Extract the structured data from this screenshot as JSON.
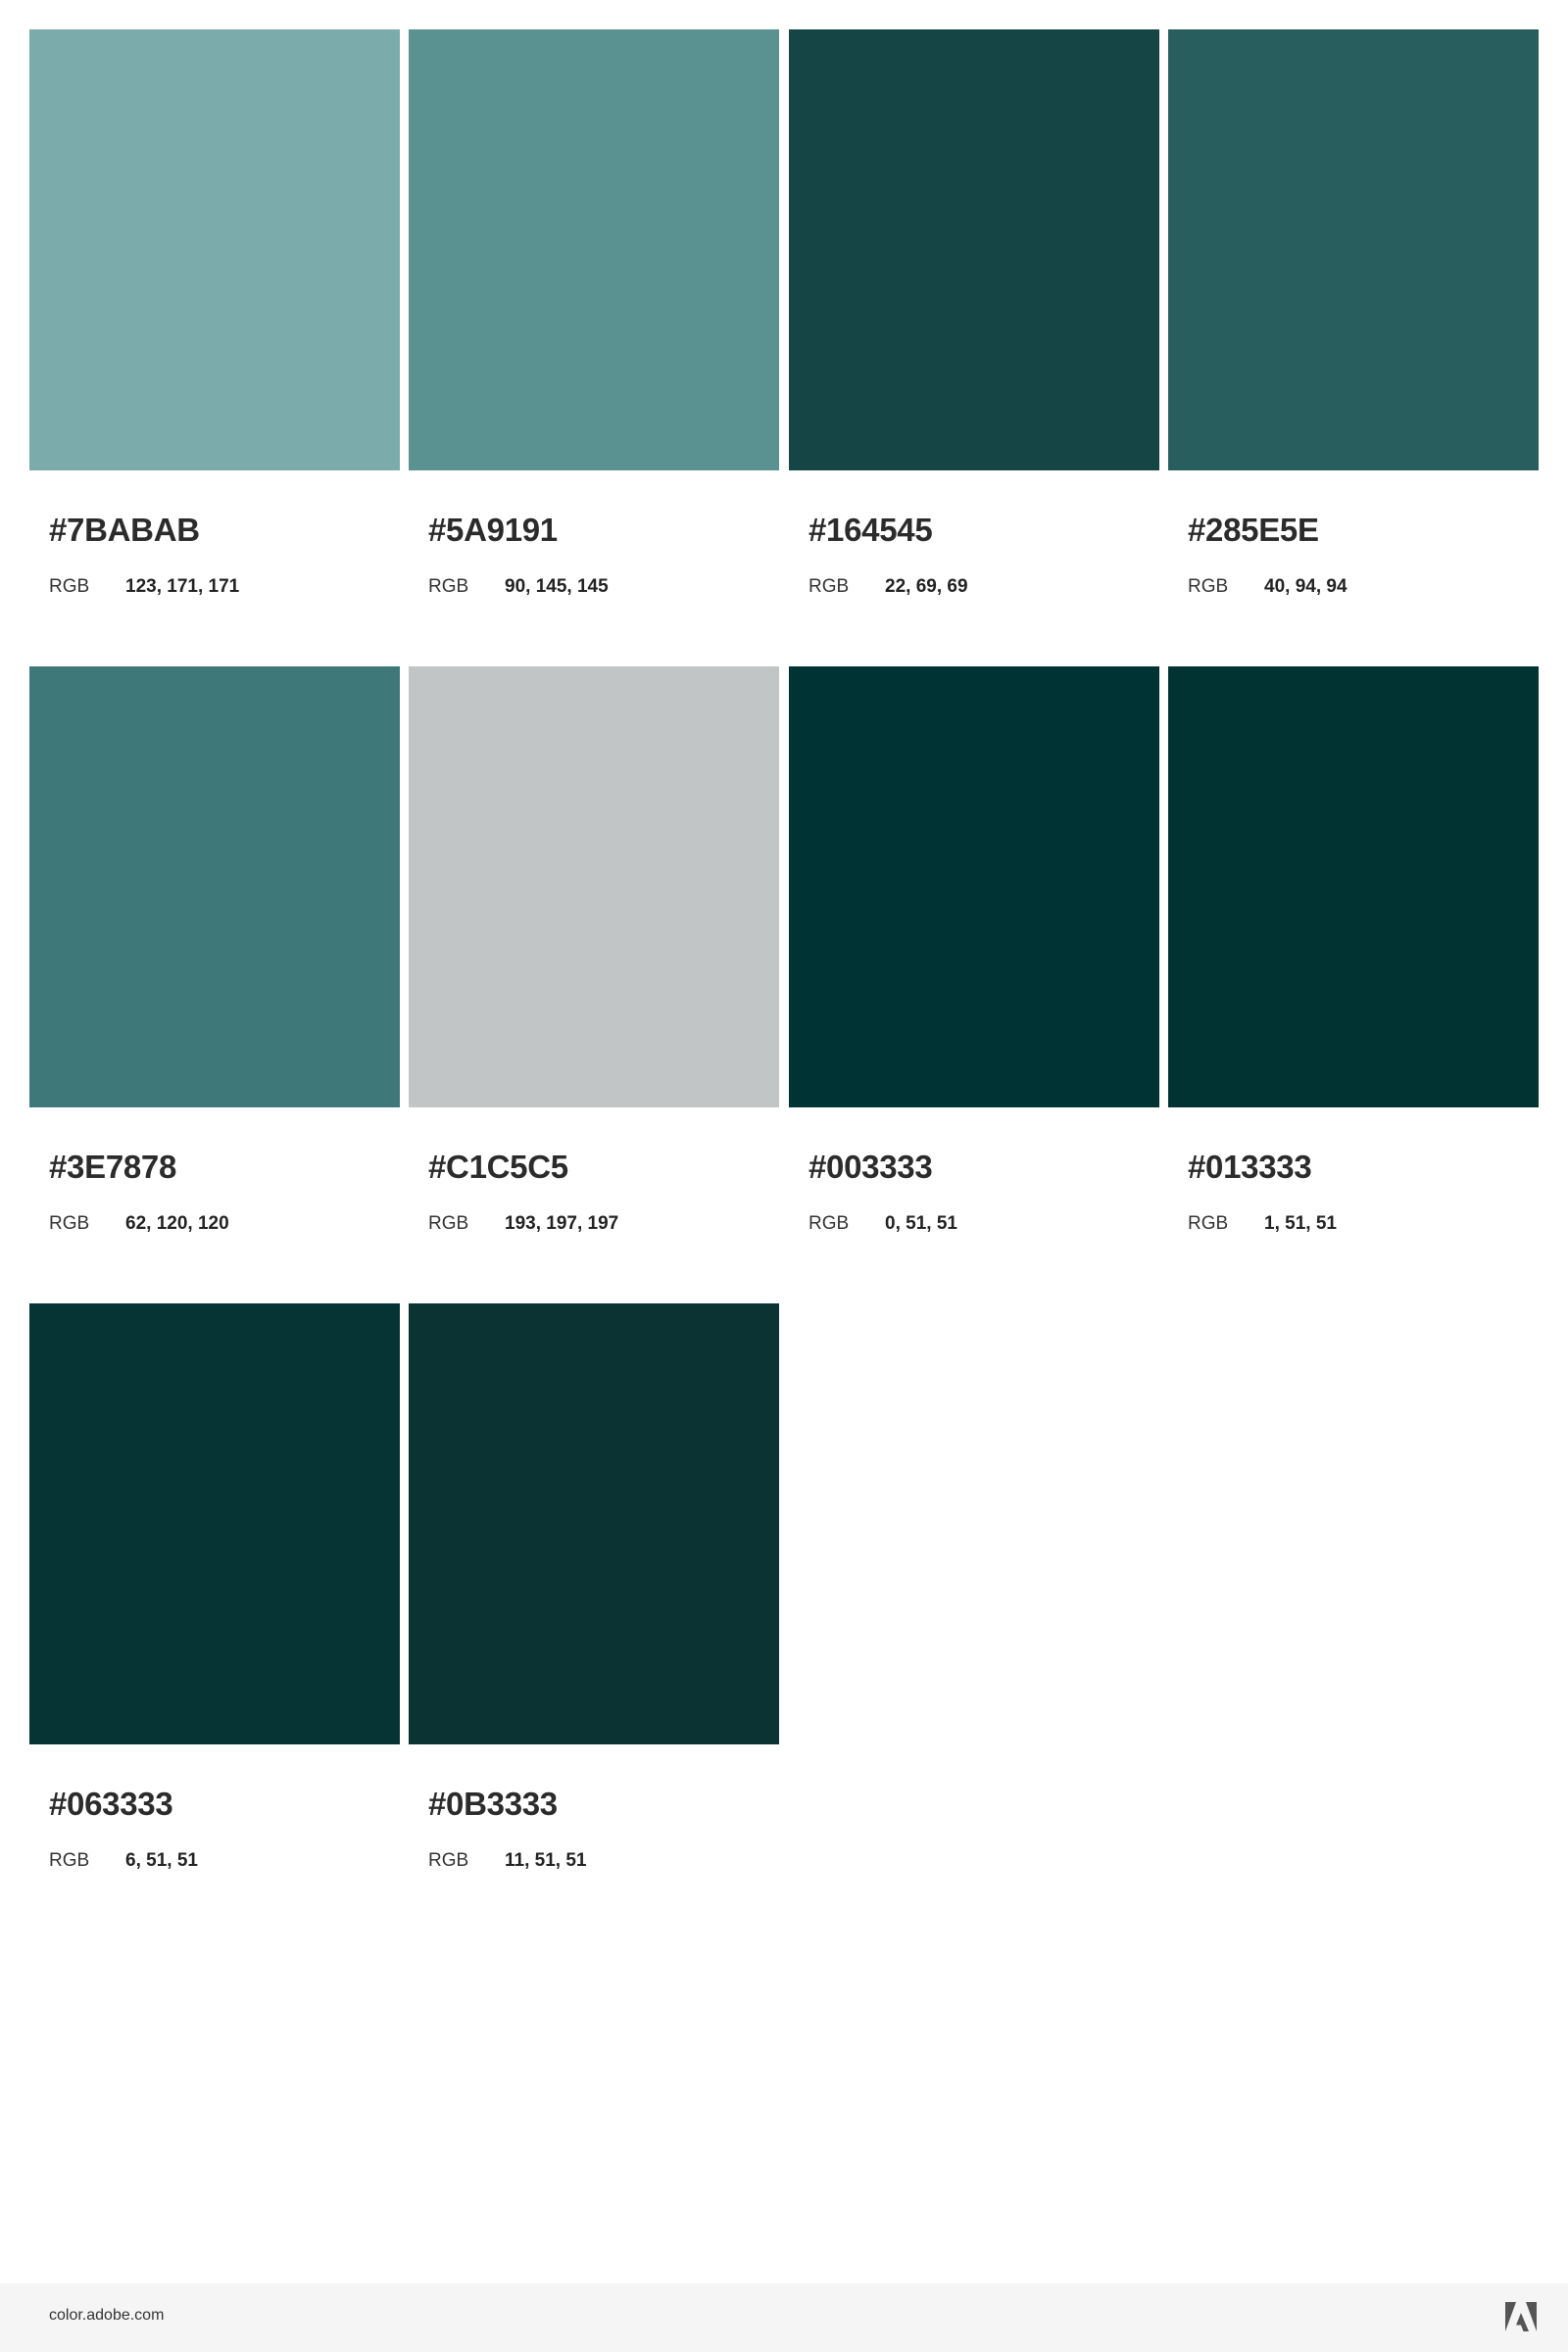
{
  "swatches": [
    {
      "hex": "#7BABAB",
      "rgb_label": "RGB",
      "rgb": "123, 171, 171",
      "color": "#7BABAB"
    },
    {
      "hex": "#5A9191",
      "rgb_label": "RGB",
      "rgb": "90, 145, 145",
      "color": "#5A9191"
    },
    {
      "hex": "#164545",
      "rgb_label": "RGB",
      "rgb": "22, 69, 69",
      "color": "#164545"
    },
    {
      "hex": "#285E5E",
      "rgb_label": "RGB",
      "rgb": "40, 94, 94",
      "color": "#285E5E"
    },
    {
      "hex": "#3E7878",
      "rgb_label": "RGB",
      "rgb": "62, 120, 120",
      "color": "#3E7878"
    },
    {
      "hex": "#C1C5C5",
      "rgb_label": "RGB",
      "rgb": "193, 197, 197",
      "color": "#C1C5C5"
    },
    {
      "hex": "#003333",
      "rgb_label": "RGB",
      "rgb": "0, 51, 51",
      "color": "#003333"
    },
    {
      "hex": "#013333",
      "rgb_label": "RGB",
      "rgb": "1, 51, 51",
      "color": "#013333"
    },
    {
      "hex": "#063333",
      "rgb_label": "RGB",
      "rgb": "6, 51, 51",
      "color": "#063333"
    },
    {
      "hex": "#0B3333",
      "rgb_label": "RGB",
      "rgb": "11, 51, 51",
      "color": "#0B3333"
    }
  ],
  "footer": {
    "url": "color.adobe.com",
    "logo_icon": "adobe-logo-icon",
    "background": "#F5F5F5",
    "logo_color": "#555555"
  }
}
